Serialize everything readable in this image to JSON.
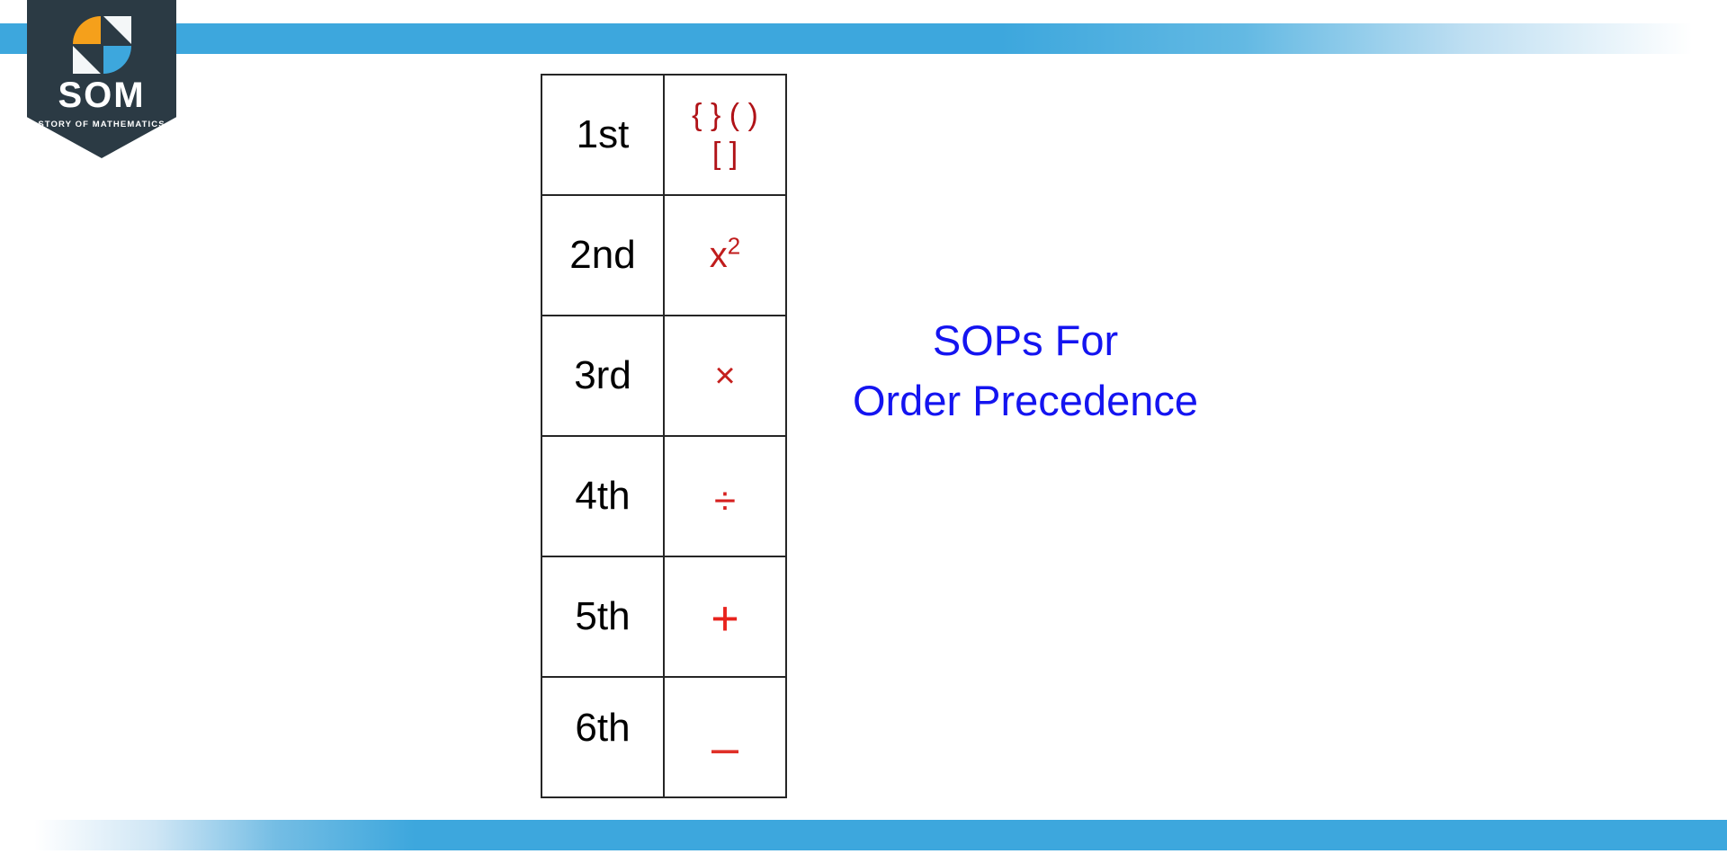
{
  "branding": {
    "logo_name": "SOM",
    "logo_tagline": "STORY OF MATHEMATICS",
    "shield_color": "#2b3a44",
    "accent_orange": "#f5a01b",
    "accent_blue": "#3da7dd",
    "accent_white": "#f4f7f8"
  },
  "decor": {
    "ribbon_color": "#3da7dd",
    "top_ribbon_name": "top-blue-ribbon",
    "bottom_ribbon_name": "bottom-blue-ribbon"
  },
  "table": {
    "name": "order-of-operations-precedence-table",
    "rank_color": "#000000",
    "symbol_color": "#b01217",
    "border_color": "#262626",
    "rows": [
      {
        "rank": "1st",
        "symbol_line_1": "{ } ( )",
        "symbol_line_2": "[ ]",
        "symbol_kind": "brackets"
      },
      {
        "rank": "2nd",
        "symbol_base": "x",
        "symbol_exponent": "2",
        "symbol_kind": "power"
      },
      {
        "rank": "3rd",
        "symbol": "×",
        "symbol_kind": "multiplication"
      },
      {
        "rank": "4th",
        "symbol": "÷",
        "symbol_kind": "division"
      },
      {
        "rank": "5th",
        "symbol": "+",
        "symbol_kind": "addition"
      },
      {
        "rank": "6th",
        "symbol": "–",
        "symbol_kind": "subtraction"
      }
    ]
  },
  "caption": {
    "line_1": "SOPs For",
    "line_2": "Order Precedence",
    "color": "#1414f0"
  }
}
